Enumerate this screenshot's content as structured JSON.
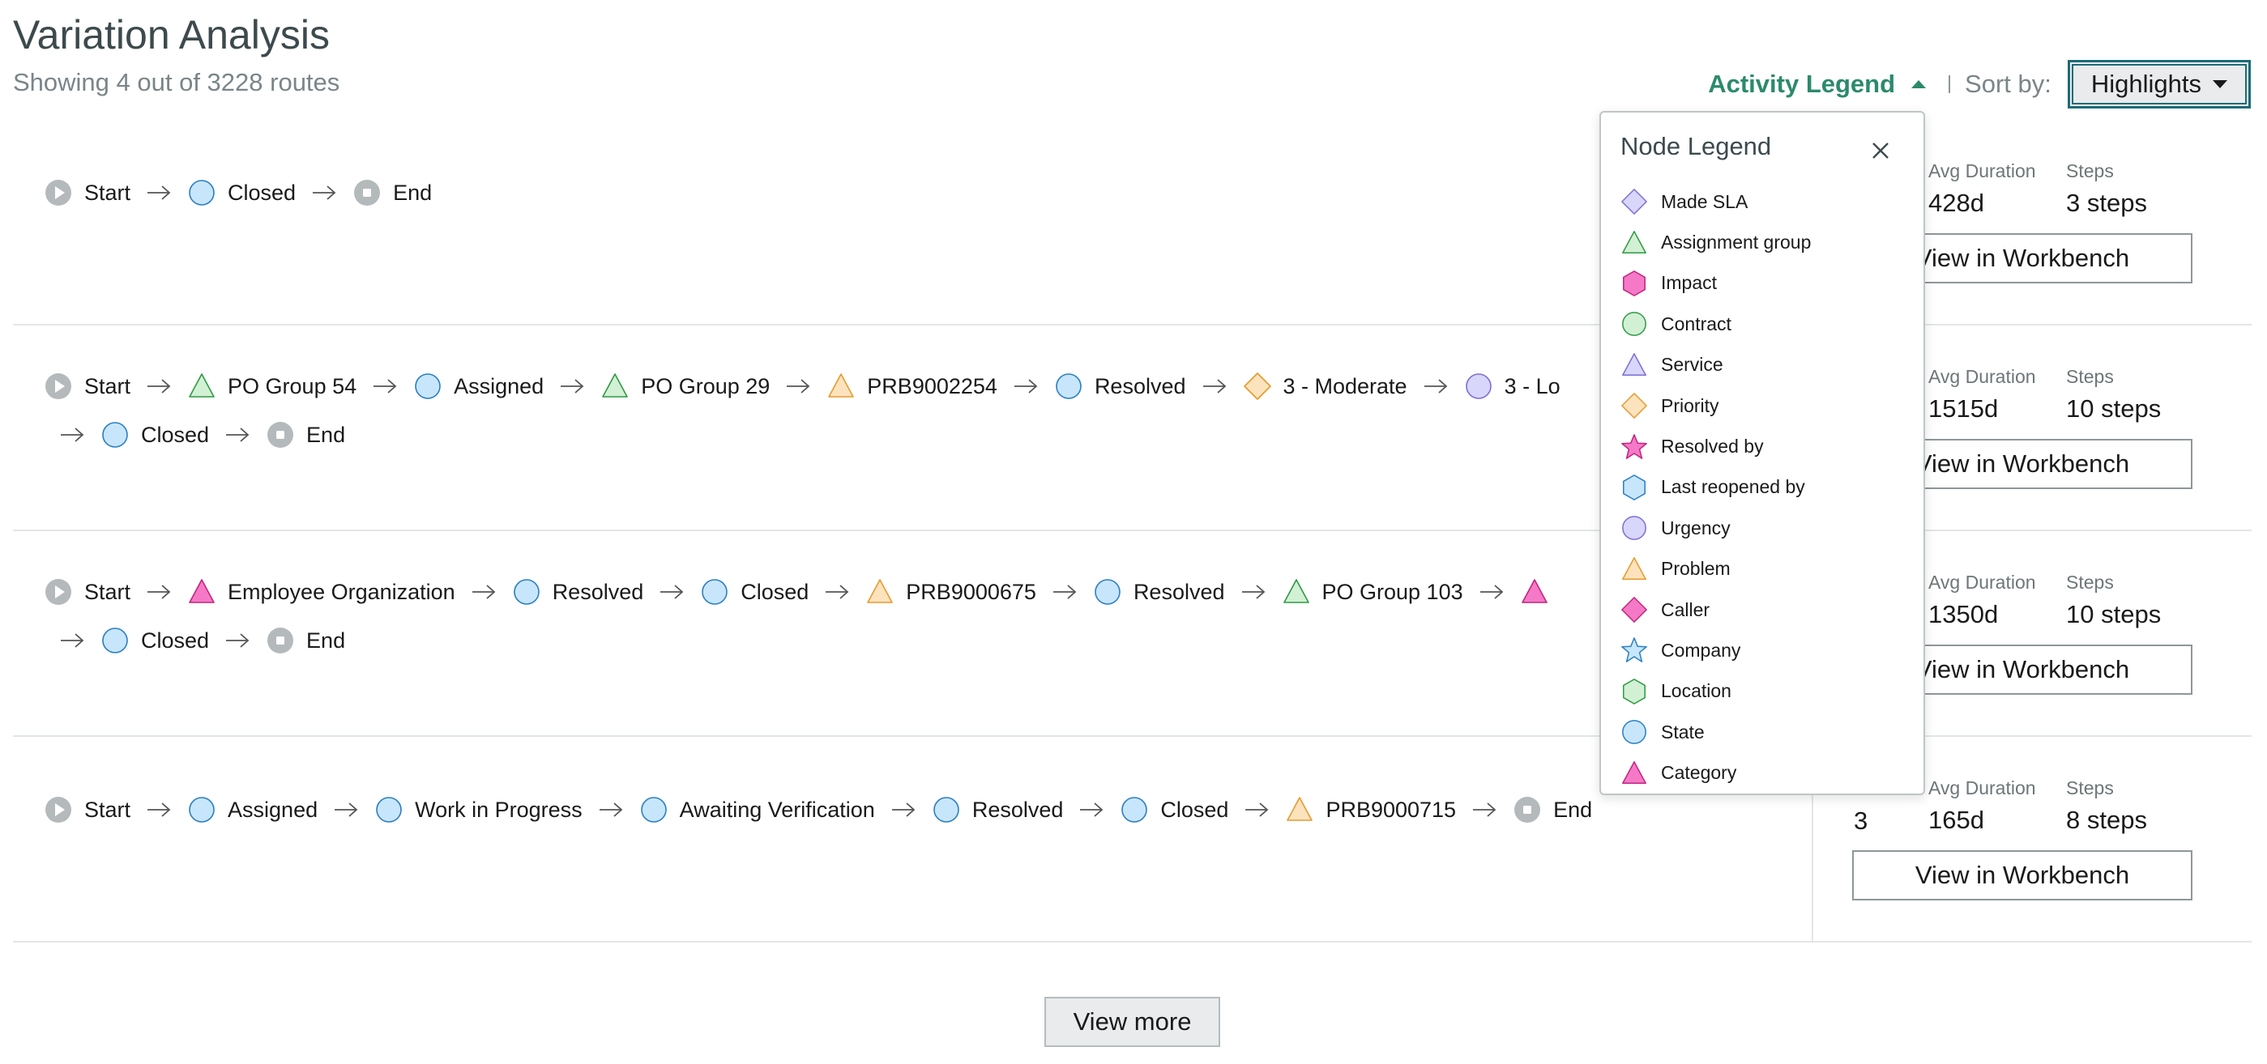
{
  "header": {
    "title": "Variation Analysis",
    "subtitle": "Showing 4 out of 3228 routes"
  },
  "toolbar": {
    "activity_legend_label": "Activity Legend",
    "sort_label": "Sort by:",
    "sort_value": "Highlights"
  },
  "legend": {
    "title": "Node Legend",
    "items": [
      {
        "label": "Made SLA",
        "shape": "diamond",
        "fill": "#d9d6fb",
        "stroke": "#7b6fd6",
        "icon": "diamond-icon"
      },
      {
        "label": "Assignment group",
        "shape": "triangle",
        "fill": "#d2f0d4",
        "stroke": "#2e9a43",
        "icon": "triangle-icon"
      },
      {
        "label": "Impact",
        "shape": "hexagon",
        "fill": "#f579c6",
        "stroke": "#c2247f",
        "icon": "hexagon-icon"
      },
      {
        "label": "Contract",
        "shape": "circle",
        "fill": "#d2f0d4",
        "stroke": "#2e9a43",
        "icon": "circle-icon"
      },
      {
        "label": "Service",
        "shape": "triangle",
        "fill": "#d9d6fb",
        "stroke": "#7b6fd6",
        "icon": "triangle-icon"
      },
      {
        "label": "Priority",
        "shape": "diamond",
        "fill": "#fde3bd",
        "stroke": "#e89a2c",
        "icon": "diamond-icon"
      },
      {
        "label": "Resolved by",
        "shape": "star",
        "fill": "#f579c6",
        "stroke": "#c2247f",
        "icon": "star-icon"
      },
      {
        "label": "Last reopened by",
        "shape": "hexagon",
        "fill": "#c8e6fb",
        "stroke": "#2a7fc4",
        "icon": "hexagon-icon"
      },
      {
        "label": "Urgency",
        "shape": "circle",
        "fill": "#d9d6fb",
        "stroke": "#7b6fd6",
        "icon": "circle-icon"
      },
      {
        "label": "Problem",
        "shape": "triangle",
        "fill": "#fde3bd",
        "stroke": "#e89a2c",
        "icon": "triangle-icon"
      },
      {
        "label": "Caller",
        "shape": "diamond",
        "fill": "#f579c6",
        "stroke": "#c2247f",
        "icon": "diamond-icon"
      },
      {
        "label": "Company",
        "shape": "star",
        "fill": "#c8e6fb",
        "stroke": "#2a7fc4",
        "icon": "star-icon"
      },
      {
        "label": "Location",
        "shape": "hexagon",
        "fill": "#d2f0d4",
        "stroke": "#2e9a43",
        "icon": "hexagon-icon"
      },
      {
        "label": "State",
        "shape": "circle",
        "fill": "#c8e6fb",
        "stroke": "#2a7fc4",
        "icon": "circle-icon"
      },
      {
        "label": "Category",
        "shape": "triangle",
        "fill": "#f579c6",
        "stroke": "#c2247f",
        "icon": "triangle-icon"
      }
    ]
  },
  "routes": [
    {
      "lines": [
        [
          {
            "label": "Start",
            "kind": "start"
          },
          {
            "label": "Closed",
            "kind": "state"
          },
          {
            "label": "End",
            "kind": "end"
          }
        ]
      ],
      "stats": {
        "count": "",
        "avg_label": "Avg Duration",
        "avg_value": "428d",
        "steps_label": "Steps",
        "steps_value": "3 steps"
      },
      "workbench_label": "View in Workbench"
    },
    {
      "lines": [
        [
          {
            "label": "Start",
            "kind": "start"
          },
          {
            "label": "PO Group 54",
            "kind": "assignment"
          },
          {
            "label": "Assigned",
            "kind": "state"
          },
          {
            "label": "PO Group 29",
            "kind": "assignment"
          },
          {
            "label": "PRB9002254",
            "kind": "problem"
          },
          {
            "label": "Resolved",
            "kind": "state"
          },
          {
            "label": "3 - Moderate",
            "kind": "priority"
          },
          {
            "label": "3 - Lo",
            "kind": "urgency"
          }
        ],
        [
          {
            "label": "Closed",
            "kind": "state"
          },
          {
            "label": "End",
            "kind": "end"
          }
        ]
      ],
      "stats": {
        "count": "",
        "avg_label": "Avg Duration",
        "avg_value": "1515d",
        "steps_label": "Steps",
        "steps_value": "10 steps"
      },
      "workbench_label": "View in Workbench"
    },
    {
      "lines": [
        [
          {
            "label": "Start",
            "kind": "start"
          },
          {
            "label": "Employee Organization",
            "kind": "category"
          },
          {
            "label": "Resolved",
            "kind": "state"
          },
          {
            "label": "Closed",
            "kind": "state"
          },
          {
            "label": "PRB9000675",
            "kind": "problem"
          },
          {
            "label": "Resolved",
            "kind": "state"
          },
          {
            "label": "PO Group 103",
            "kind": "assignment"
          },
          {
            "label": "",
            "kind": "category"
          }
        ],
        [
          {
            "label": "Closed",
            "kind": "state"
          },
          {
            "label": "End",
            "kind": "end"
          }
        ]
      ],
      "stats": {
        "count": "",
        "avg_label": "Avg Duration",
        "avg_value": "1350d",
        "steps_label": "Steps",
        "steps_value": "10 steps"
      },
      "workbench_label": "View in Workbench"
    },
    {
      "lines": [
        [
          {
            "label": "Start",
            "kind": "start"
          },
          {
            "label": "Assigned",
            "kind": "state"
          },
          {
            "label": "Work in Progress",
            "kind": "state"
          },
          {
            "label": "Awaiting Verification",
            "kind": "state"
          },
          {
            "label": "Resolved",
            "kind": "state"
          },
          {
            "label": "Closed",
            "kind": "state"
          },
          {
            "label": "PRB9000715",
            "kind": "problem"
          },
          {
            "label": "End",
            "kind": "end"
          }
        ]
      ],
      "stats": {
        "count": "3",
        "avg_label": "Avg Duration",
        "avg_value": "165d",
        "steps_label": "Steps",
        "steps_value": "8 steps"
      },
      "workbench_label": "View in Workbench"
    }
  ],
  "node_styles": {
    "start": {
      "shape": "play",
      "fill": "#b4b9bb",
      "icon": "start-icon"
    },
    "end": {
      "shape": "stop",
      "fill": "#b4b9bb",
      "icon": "end-icon"
    },
    "state": {
      "shape": "circle",
      "fill": "#c8e6fb",
      "stroke": "#2a7fc4",
      "icon": "circle-icon"
    },
    "assignment": {
      "shape": "triangle",
      "fill": "#d2f0d4",
      "stroke": "#2e9a43",
      "icon": "triangle-icon"
    },
    "problem": {
      "shape": "triangle",
      "fill": "#fde3bd",
      "stroke": "#e89a2c",
      "icon": "triangle-icon"
    },
    "priority": {
      "shape": "diamond",
      "fill": "#fde3bd",
      "stroke": "#e89a2c",
      "icon": "diamond-icon"
    },
    "urgency": {
      "shape": "circle",
      "fill": "#d9d6fb",
      "stroke": "#7b6fd6",
      "icon": "circle-icon"
    },
    "category": {
      "shape": "triangle",
      "fill": "#f579c6",
      "stroke": "#c2247f",
      "icon": "triangle-icon"
    }
  },
  "footer": {
    "view_more_label": "View more"
  }
}
